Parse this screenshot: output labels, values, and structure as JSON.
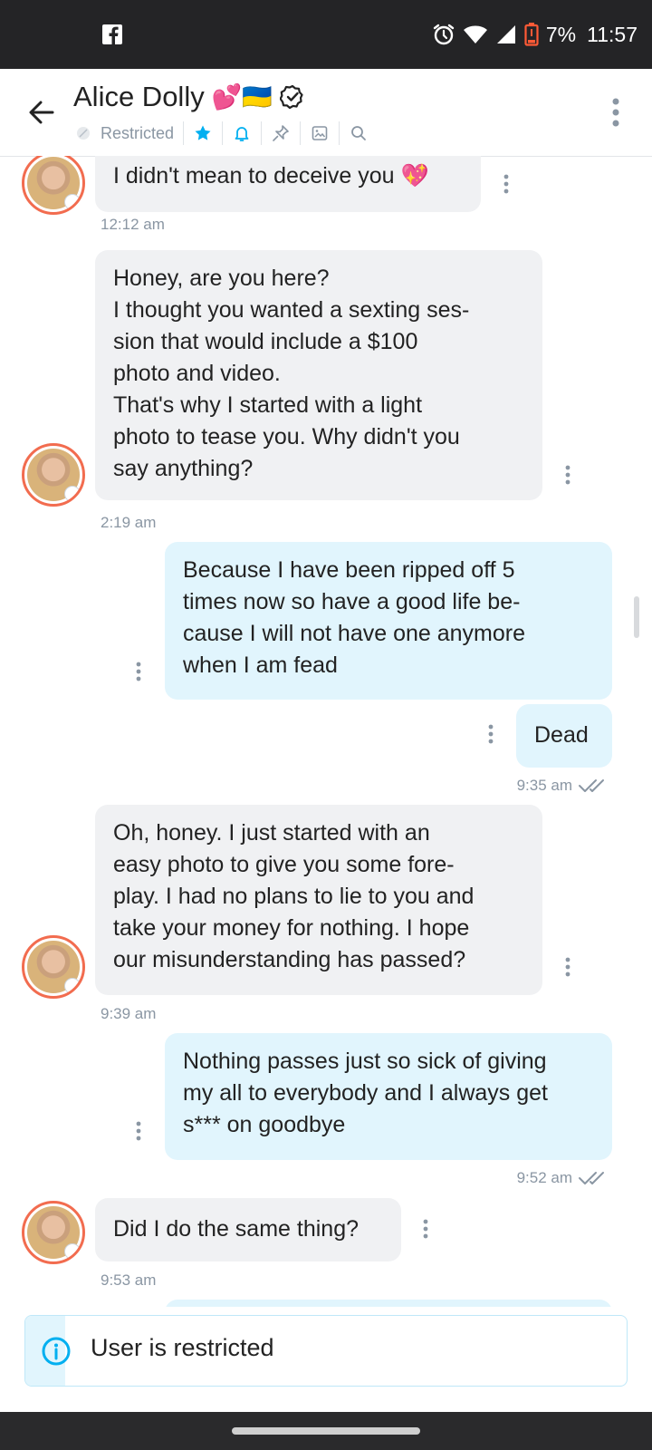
{
  "status_bar": {
    "battery": "7%",
    "time": "11:57"
  },
  "header": {
    "contact_name": "Alice Dolly",
    "emoji": "💕🇺🇦",
    "status": "Restricted"
  },
  "messages": [
    {
      "id": "m1",
      "direction": "in",
      "lines": [
        "I didn't mean to deceive you 💖"
      ],
      "time": "12:12 am"
    },
    {
      "id": "m2",
      "direction": "in",
      "lines": [
        "Honey, are you here?",
        "I thought you wanted a sexting ses-",
        "sion that would include a $100",
        "photo and video.",
        "That's why I started with a light",
        "photo to tease you. Why didn't you",
        "say anything?"
      ],
      "time": "2:19 am"
    },
    {
      "id": "m3",
      "direction": "out",
      "lines": [
        "Because I have been ripped off 5",
        "times now so have a good life be-",
        "cause I will not have one anymore",
        "when I am fead"
      ]
    },
    {
      "id": "m4",
      "direction": "out",
      "lines": [
        "Dead"
      ],
      "time": "9:35 am"
    },
    {
      "id": "m5",
      "direction": "in",
      "lines": [
        "Oh, honey. I just started with an",
        "easy photo to give you some fore-",
        "play. I had no plans to lie to you and",
        "take your money for nothing. I hope",
        "our misunderstanding has passed?"
      ],
      "time": "9:39 am"
    },
    {
      "id": "m6",
      "direction": "out",
      "lines": [
        "Nothing passes just so sick of giving",
        "my all to everybody and I always get",
        "s*** on goodbye"
      ],
      "time": "9:52 am"
    },
    {
      "id": "m7",
      "direction": "in",
      "lines": [
        "Did I do the same thing?"
      ],
      "time": "9:53 am"
    }
  ],
  "restricted_banner": {
    "text": "User is restricted"
  },
  "colors": {
    "accent": "#00aff0",
    "incoming_bubble": "#f0f1f3",
    "outgoing_bubble": "#e1f5fd",
    "avatar_ring": "#f26c4f"
  }
}
